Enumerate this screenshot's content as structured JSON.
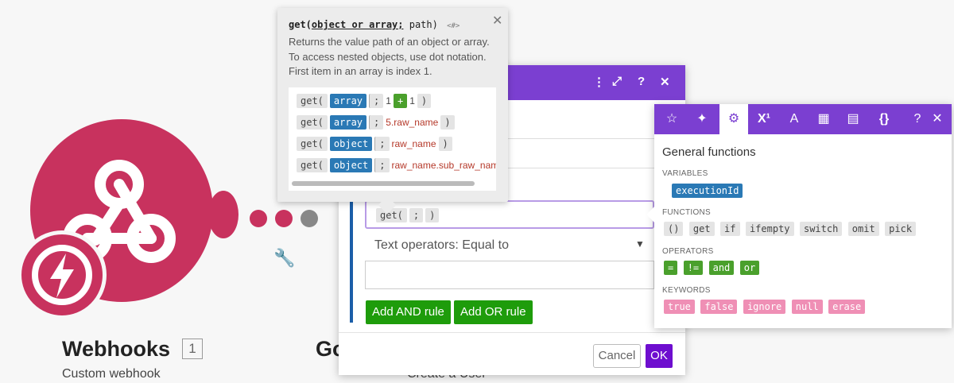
{
  "module1": {
    "title": "Webhooks",
    "count": "1",
    "subtitle": "Custom webhook"
  },
  "module2": {
    "title": "Go",
    "subtitle": "Create a User"
  },
  "tooltip": {
    "fn": "get(",
    "args": "object or array;",
    "tail": " path)",
    "badge": "<#>",
    "description": "Returns the value path of an object or array. To access nested objects, use dot notation. First item in an array is index 1.",
    "examples": [
      {
        "open": "get(",
        "type": "array",
        "sep": ";",
        "rest": [
          "1",
          "+",
          "1"
        ],
        "close": ")"
      },
      {
        "open": "get(",
        "type": "array",
        "sep": ";",
        "path": "5.raw_name",
        "close": ")"
      },
      {
        "open": "get(",
        "type": "object",
        "sep": ";",
        "path": "raw_name",
        "close": ")"
      },
      {
        "open": "get(",
        "type": "object",
        "sep": ";",
        "path": "raw_name.sub_raw_name",
        "close": ""
      }
    ]
  },
  "dialog": {
    "expr": {
      "open": "get(",
      "sep": ";",
      "close": ")"
    },
    "operator": "Text operators: Equal to",
    "add_and": "Add AND rule",
    "add_or": "Add OR rule",
    "cancel": "Cancel",
    "ok": "OK"
  },
  "panel": {
    "title": "General functions",
    "sections": {
      "variables": {
        "label": "VARIABLES",
        "items": [
          "executionId"
        ]
      },
      "functions": {
        "label": "FUNCTIONS",
        "items": [
          "()",
          "get",
          "if",
          "ifempty",
          "switch",
          "omit",
          "pick"
        ]
      },
      "operators": {
        "label": "OPERATORS",
        "items": [
          "=",
          "!=",
          "and",
          "or"
        ]
      },
      "keywords": {
        "label": "KEYWORDS",
        "items": [
          "true",
          "false",
          "ignore",
          "null",
          "erase"
        ]
      }
    },
    "tabs": [
      "star-icon",
      "sparkle-icon",
      "gear-icon",
      "superscript-icon",
      "text-icon",
      "calendar-icon",
      "table-icon",
      "braces-icon",
      "help-icon",
      "close-icon"
    ]
  },
  "colors": {
    "accent": "#7b3fd1",
    "module": "#c8325e",
    "green": "#1e9c0b",
    "ok": "#6e0ecf"
  }
}
